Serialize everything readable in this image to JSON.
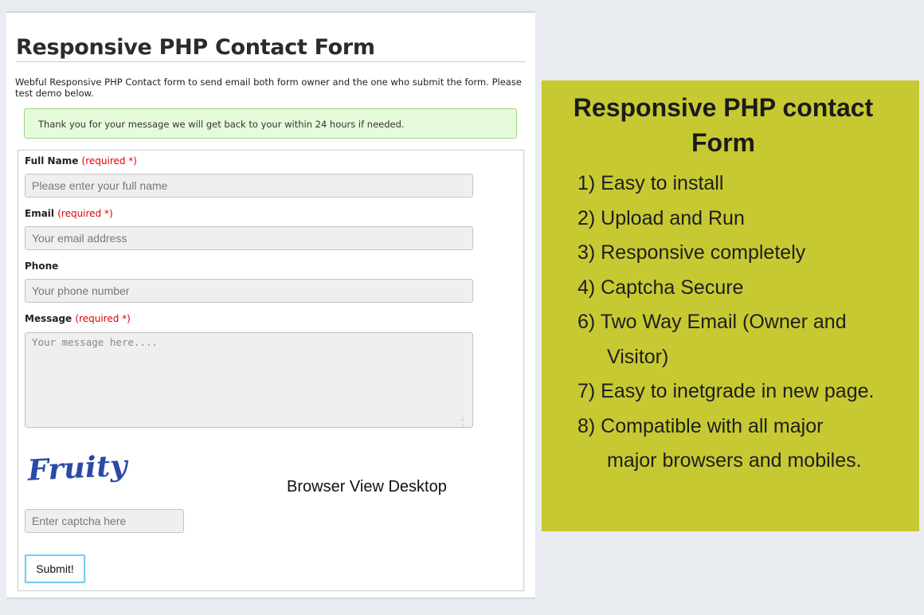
{
  "page": {
    "title": "Responsive PHP Contact Form",
    "intro": "Webful Responsive PHP Contact form to send email both form owner and the one who submit the form. Please test demo below.",
    "success_message": "Thank you for your message we will get back to your within 24 hours if needed."
  },
  "form": {
    "required_marker": "(required *)",
    "full_name": {
      "label": "Full Name",
      "placeholder": "Please enter your full name"
    },
    "email": {
      "label": "Email",
      "placeholder": "Your email address"
    },
    "phone": {
      "label": "Phone",
      "placeholder": "Your phone number"
    },
    "message": {
      "label": "Message",
      "placeholder": "Your message here...."
    },
    "captcha": {
      "image_text": "Fruity",
      "placeholder": "Enter captcha here"
    },
    "submit_label": "Submit!",
    "browser_view_label": "Browser View Desktop"
  },
  "panel": {
    "title_line1": "Responsive PHP contact",
    "title_line2": "Form",
    "features": [
      "1) Easy to install",
      "2) Upload and Run",
      "3) Responsive completely",
      "4) Captcha Secure",
      "6) Two Way Email (Owner and",
      "Visitor)",
      "7) Easy to inetgrade in new page.",
      "8) Compatible with all major",
      "major browsers and mobiles."
    ],
    "background_color": "#c7c932"
  },
  "colors": {
    "required": "#e00000",
    "alert_bg": "#e6fbd9",
    "alert_border": "#9ed289",
    "submit_border": "#79cdf0",
    "captcha_text": "#2a49a8"
  }
}
